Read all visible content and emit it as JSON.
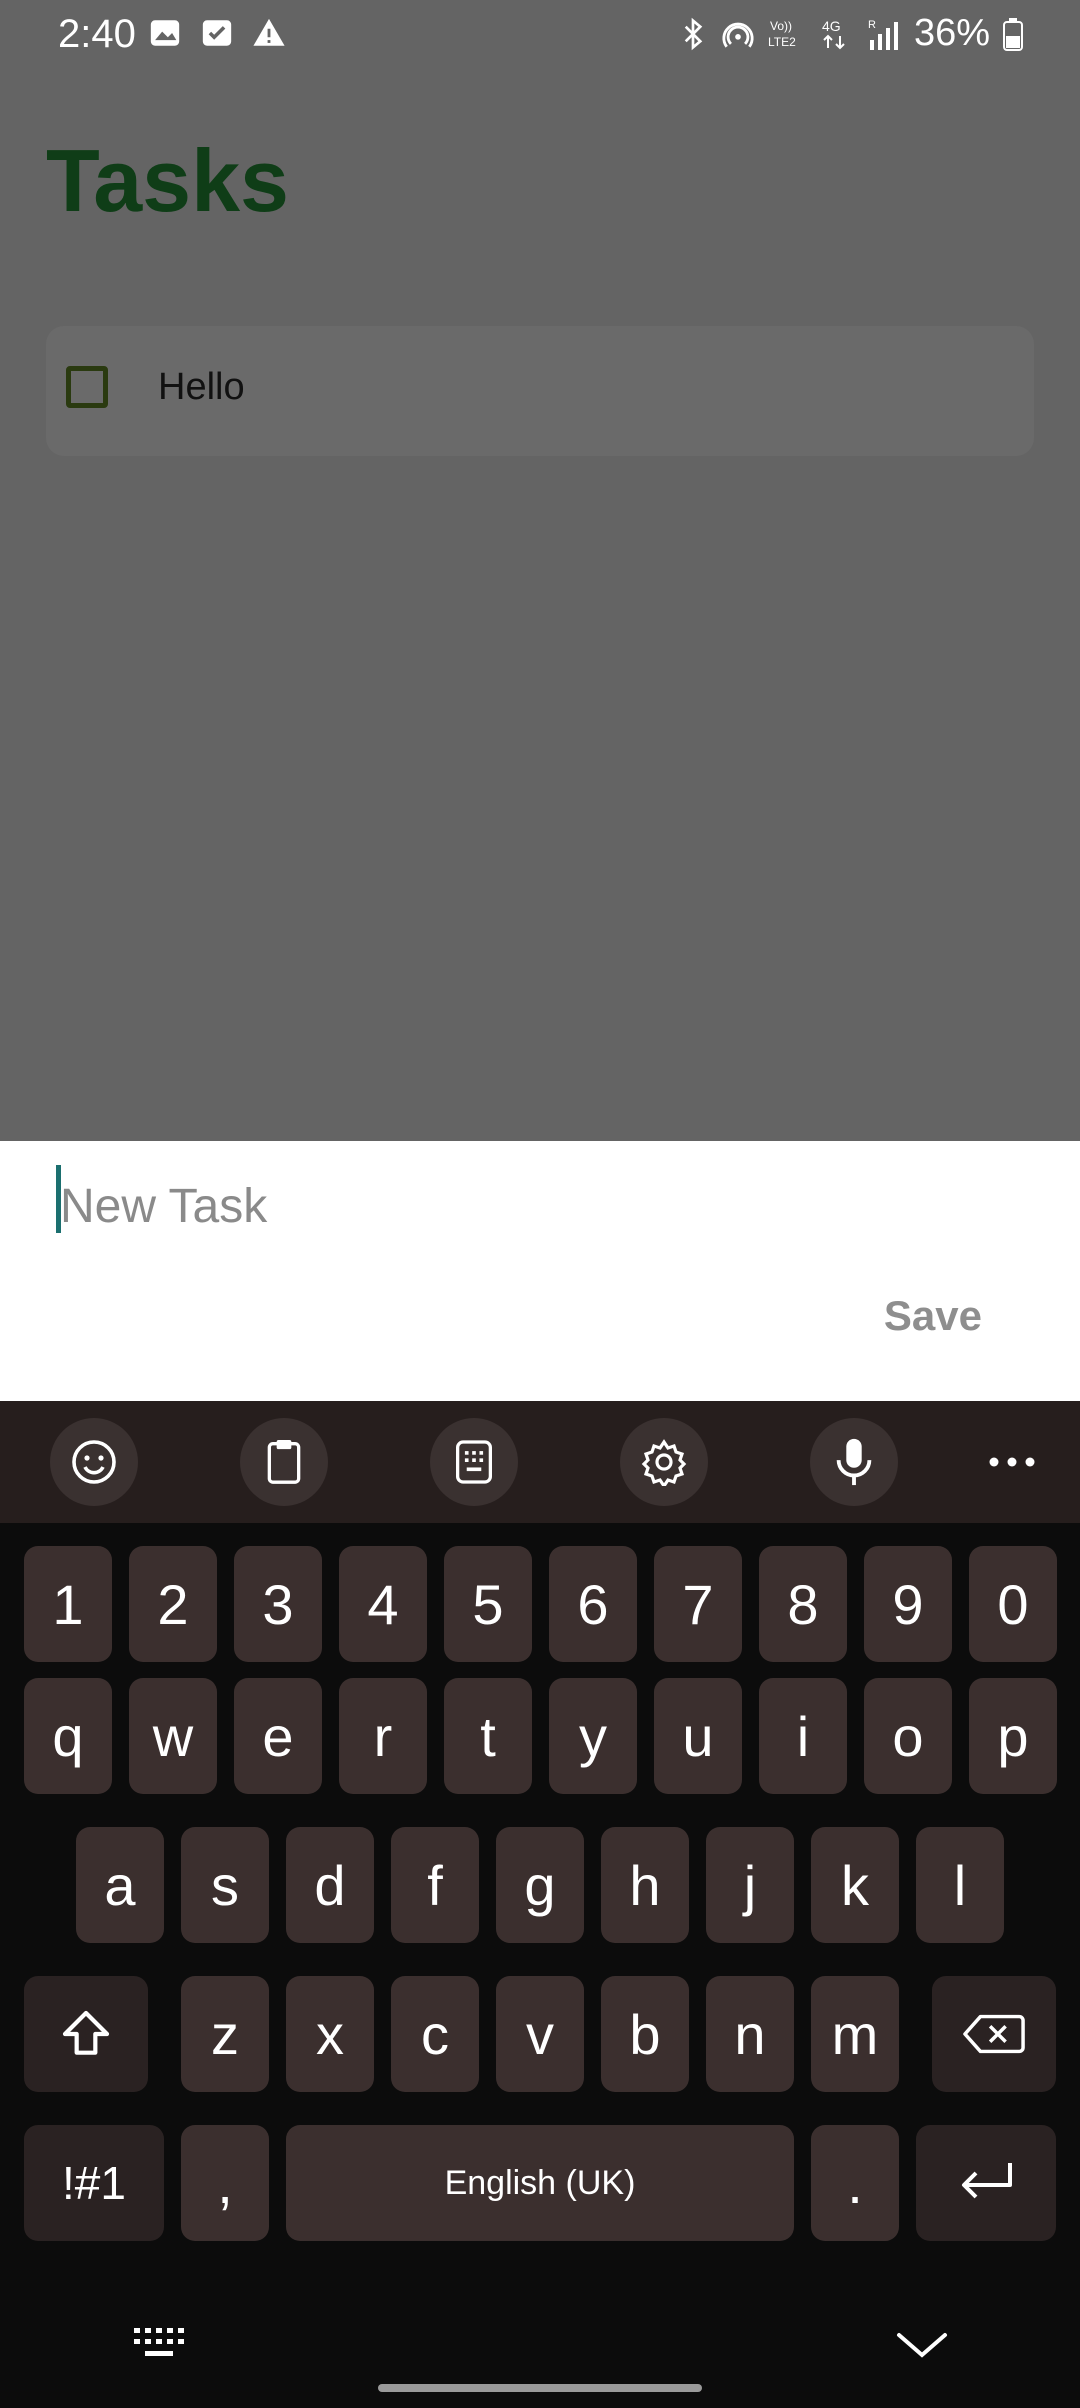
{
  "status": {
    "time": "2:40",
    "network": "4G",
    "volte": "VoLTE2",
    "battery": "36%"
  },
  "app": {
    "title": "Tasks",
    "tasks": [
      {
        "label": "Hello",
        "done": false
      }
    ]
  },
  "sheet": {
    "placeholder": "New Task",
    "value": "",
    "save_label": "Save"
  },
  "keyboard": {
    "row_numbers": [
      "1",
      "2",
      "3",
      "4",
      "5",
      "6",
      "7",
      "8",
      "9",
      "0"
    ],
    "row_q": [
      "q",
      "w",
      "e",
      "r",
      "t",
      "y",
      "u",
      "i",
      "o",
      "p"
    ],
    "row_a": [
      "a",
      "s",
      "d",
      "f",
      "g",
      "h",
      "j",
      "k",
      "l"
    ],
    "row_z": [
      "z",
      "x",
      "c",
      "v",
      "b",
      "n",
      "m"
    ],
    "symbols_label": "!#1",
    "comma": ",",
    "space_label": "English (UK)",
    "period": "."
  }
}
